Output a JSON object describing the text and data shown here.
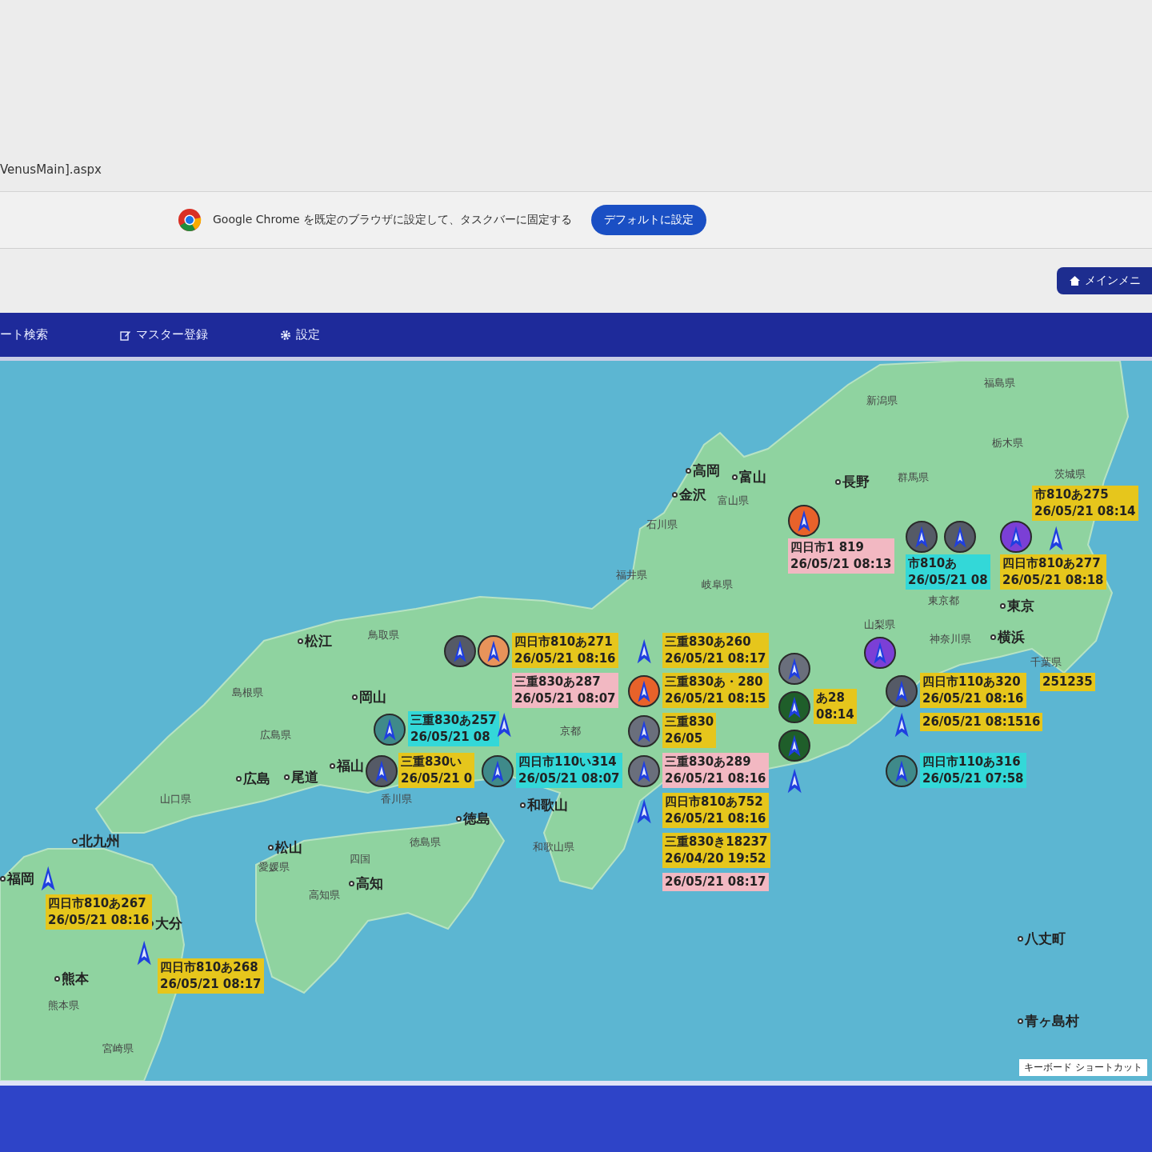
{
  "address_bar": {
    "url": "VenusMain].aspx"
  },
  "browser_banner": {
    "message": "Google Chrome を既定のブラウザに設定して、タスクバーに固定する",
    "button": "デフォルトに設定"
  },
  "main_menu_button": {
    "label": "メインメニ"
  },
  "nav": [
    {
      "label": "ート検索"
    },
    {
      "label": "マスター登録"
    },
    {
      "label": "設定"
    }
  ],
  "map": {
    "place_labels": [
      {
        "text": "松江",
        "dot": true
      },
      {
        "text": "鳥取県",
        "dot": false
      },
      {
        "text": "島根県",
        "dot": false
      },
      {
        "text": "岡山",
        "dot": true
      },
      {
        "text": "広島県",
        "dot": false
      },
      {
        "text": "福山",
        "dot": true
      },
      {
        "text": "広島",
        "dot": true
      },
      {
        "text": "尾道",
        "dot": true
      },
      {
        "text": "山口県",
        "dot": false
      },
      {
        "text": "北九州",
        "dot": true
      },
      {
        "text": "福岡",
        "dot": true
      },
      {
        "text": "大分",
        "dot": true
      },
      {
        "text": "熊本",
        "dot": true
      },
      {
        "text": "熊本県",
        "dot": false
      },
      {
        "text": "宮崎県",
        "dot": false
      },
      {
        "text": "松山",
        "dot": true
      },
      {
        "text": "愛媛県",
        "dot": false
      },
      {
        "text": "四国",
        "dot": false
      },
      {
        "text": "高知",
        "dot": true
      },
      {
        "text": "高知県",
        "dot": false
      },
      {
        "text": "徳島",
        "dot": true
      },
      {
        "text": "徳島県",
        "dot": false
      },
      {
        "text": "香川県",
        "dot": false
      },
      {
        "text": "和歌山",
        "dot": true
      },
      {
        "text": "和歌山県",
        "dot": false
      },
      {
        "text": "京都",
        "dot": false
      },
      {
        "text": "福井県",
        "dot": false
      },
      {
        "text": "石川県",
        "dot": false
      },
      {
        "text": "岐阜県",
        "dot": false
      },
      {
        "text": "金沢",
        "dot": true
      },
      {
        "text": "高岡",
        "dot": true
      },
      {
        "text": "富山",
        "dot": true
      },
      {
        "text": "富山県",
        "dot": false
      },
      {
        "text": "長野",
        "dot": true
      },
      {
        "text": "群馬県",
        "dot": false
      },
      {
        "text": "栃木県",
        "dot": false
      },
      {
        "text": "新潟県",
        "dot": false
      },
      {
        "text": "福島県",
        "dot": false
      },
      {
        "text": "茨城県",
        "dot": false
      },
      {
        "text": "東京都",
        "dot": false
      },
      {
        "text": "東京",
        "dot": true
      },
      {
        "text": "横浜",
        "dot": true
      },
      {
        "text": "山梨県",
        "dot": false
      },
      {
        "text": "神奈川県",
        "dot": false
      },
      {
        "text": "千葉県",
        "dot": false
      },
      {
        "text": "八丈町",
        "dot": true
      },
      {
        "text": "青ヶ島村",
        "dot": true
      }
    ],
    "vehicle_labels": [
      {
        "lines": [
          "四日市1 819",
          "26/05/21 08:13"
        ],
        "color": "#f2b8c2"
      },
      {
        "lines": [
          "市810あ",
          "26/05/21 08"
        ],
        "color": "#33d8d8"
      },
      {
        "lines": [
          "四日市810あ277",
          "26/05/21 08:18"
        ],
        "color": "#e6c61c"
      },
      {
        "lines": [
          "市810あ275",
          "26/05/21 08:14"
        ],
        "color": "#e6c61c"
      },
      {
        "lines": [
          "四日市810あ271",
          "26/05/21 08:16"
        ],
        "color": "#e6c61c"
      },
      {
        "lines": [
          "三重830あ287",
          "26/05/21 08:07"
        ],
        "color": "#f2b8c2"
      },
      {
        "lines": [
          "三重830あ257",
          "26/05/21 08"
        ],
        "color": "#33d8d8"
      },
      {
        "lines": [
          "三重830い",
          "26/05/21 0"
        ],
        "color": "#e6c61c"
      },
      {
        "lines": [
          "四日市110い314",
          "26/05/21 08:07"
        ],
        "color": "#33d8d8"
      },
      {
        "lines": [
          "三重830あ260",
          "26/05/21 08:17"
        ],
        "color": "#e6c61c"
      },
      {
        "lines": [
          "三重830あ・280",
          "26/05/21 08:15"
        ],
        "color": "#e6c61c"
      },
      {
        "lines": [
          "三重830",
          "26/05"
        ],
        "color": "#e6c61c"
      },
      {
        "lines": [
          "三重830あ289",
          "26/05/21 08:16"
        ],
        "color": "#f2b8c2"
      },
      {
        "lines": [
          "四日市810あ752",
          "26/05/21 08:16"
        ],
        "color": "#e6c61c"
      },
      {
        "lines": [
          "三重830き18237",
          "26/04/20 19:52"
        ],
        "color": "#e6c61c"
      },
      {
        "lines": [
          "26/05/21 08:17"
        ],
        "color": "#f2b8c2"
      },
      {
        "lines": [
          "あ28",
          "08:14"
        ],
        "color": "#e6c61c"
      },
      {
        "lines": [
          "四日市110あ320",
          "26/05/21 08:16"
        ],
        "color": "#e6c61c"
      },
      {
        "lines": [
          "251235"
        ],
        "color": "#e6c61c"
      },
      {
        "lines": [
          "26/05/21 08:1516"
        ],
        "color": "#e6c61c"
      },
      {
        "lines": [
          "四日市110あ316",
          "26/05/21 07:58"
        ],
        "color": "#33d8d8"
      },
      {
        "lines": [
          "四日市810あ267",
          "26/05/21 08:16"
        ],
        "color": "#e6c61c"
      },
      {
        "lines": [
          "四日市810あ268",
          "26/05/21 08:17"
        ],
        "color": "#e6c61c"
      }
    ],
    "markers": [
      {
        "kind": "circle",
        "color": "#e8622a"
      },
      {
        "kind": "circle",
        "color": "#555a66"
      },
      {
        "kind": "circle",
        "color": "#555a66"
      },
      {
        "kind": "circle",
        "color": "#7b3fd6"
      },
      {
        "kind": "arrow"
      },
      {
        "kind": "circle",
        "color": "#555a66"
      },
      {
        "kind": "circle",
        "color": "#e8935a"
      },
      {
        "kind": "circle",
        "color": "#3f8a8a"
      },
      {
        "kind": "circle",
        "color": "#555a66"
      },
      {
        "kind": "circle",
        "color": "#3f8a8a"
      },
      {
        "kind": "arrow"
      },
      {
        "kind": "arrow"
      },
      {
        "kind": "circle",
        "color": "#e8622a"
      },
      {
        "kind": "circle",
        "color": "#6a6f7c"
      },
      {
        "kind": "arrow"
      },
      {
        "kind": "circle",
        "color": "#6a6f7c"
      },
      {
        "kind": "circle",
        "color": "#6a6f7c"
      },
      {
        "kind": "circle",
        "color": "#1f5e2a"
      },
      {
        "kind": "circle",
        "color": "#1f5e2a"
      },
      {
        "kind": "arrow"
      },
      {
        "kind": "circle",
        "color": "#7b3fd6"
      },
      {
        "kind": "circle",
        "color": "#555a66"
      },
      {
        "kind": "arrow"
      },
      {
        "kind": "circle",
        "color": "#3f8a8a"
      },
      {
        "kind": "arrow"
      },
      {
        "kind": "arrow"
      }
    ],
    "shortcut_link": "キーボード ショートカット"
  }
}
